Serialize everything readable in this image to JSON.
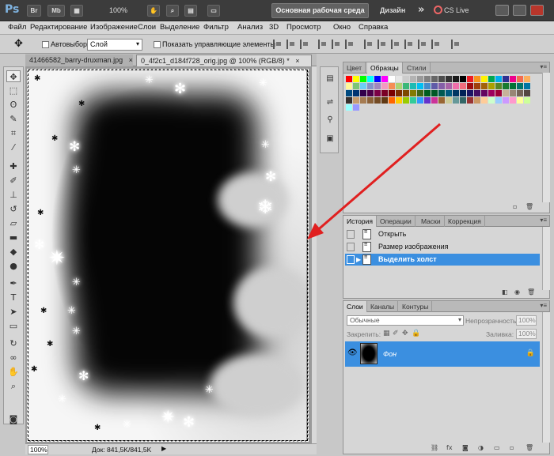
{
  "app": {
    "logo": "Ps",
    "btn_br": "Br",
    "btn_mb": "Mb",
    "zoom": "100%",
    "workspace_active": "Основная рабочая среда",
    "workspace_design": "Дизайн",
    "more": "»",
    "cs_live": "CS Live"
  },
  "menu": [
    "Файл",
    "Редактирование",
    "Изображение",
    "Слои",
    "Выделение",
    "Фильтр",
    "Анализ",
    "3D",
    "Просмотр",
    "Окно",
    "Справка"
  ],
  "options": {
    "autoselect_label": "Автовыбор:",
    "autoselect_value": "Слой",
    "show_controls_label": "Показать управляющие элементы"
  },
  "documents": {
    "tab1": "41466582_barry-druxman.jpg",
    "tab2": "0_4f2c1_d184f728_orig.jpg @ 100% (RGB/8) *",
    "close_glyph": "×"
  },
  "status": {
    "zoom": "100%",
    "doc_size": "Док: 841,5K/841,5K",
    "arrow": "▶"
  },
  "swatches_panel": {
    "tabs": [
      "Цвет",
      "Образцы",
      "Стили"
    ],
    "active_tab": 1,
    "colors": [
      "#ff0000",
      "#ffff00",
      "#00ff00",
      "#00ffff",
      "#0000ff",
      "#ff00ff",
      "#ffffff",
      "#e6e6e6",
      "#cccccc",
      "#b3b3b3",
      "#999999",
      "#808080",
      "#666666",
      "#4d4d4d",
      "#333333",
      "#1a1a1a",
      "#000000",
      "#ed1c24",
      "#f7941d",
      "#fff200",
      "#00a651",
      "#00aeef",
      "#2e3192",
      "#ec008c",
      "#f26c4f",
      "#fbaf5d",
      "#fff799",
      "#7cc576",
      "#6dcff6",
      "#8393ca",
      "#a186be",
      "#f49ac1",
      "#f68e56",
      "#acd373",
      "#3bb878",
      "#1cbbb4",
      "#00bff3",
      "#448ccb",
      "#605ca8",
      "#855fa8",
      "#a864a8",
      "#f06eaa",
      "#f26d7d",
      "#9e0b0f",
      "#a0410d",
      "#a3620a",
      "#aba000",
      "#598527",
      "#197b30",
      "#007236",
      "#00746b",
      "#0076a3",
      "#004a80",
      "#003471",
      "#32004b",
      "#4b0049",
      "#7b0046",
      "#7a0026",
      "#790000",
      "#7b2e00",
      "#7d4900",
      "#827b00",
      "#406618",
      "#005e20",
      "#005826",
      "#005952",
      "#005b7f",
      "#003663",
      "#002157",
      "#1b1464",
      "#440e62",
      "#630460",
      "#9e005d",
      "#9e0039",
      "#c7b299",
      "#998675",
      "#736357",
      "#534741",
      "#37302d",
      "#c69c6d",
      "#a67c52",
      "#8c6239",
      "#754c24",
      "#603913",
      "#ff6600",
      "#ffcc00",
      "#99cc00",
      "#33cc99",
      "#3399ff",
      "#6633cc",
      "#cc3399",
      "#996633",
      "#cccc99",
      "#669999",
      "#336666",
      "#993333",
      "#cc9966",
      "#ffcc99",
      "#ccffcc",
      "#99ccff",
      "#cc99ff",
      "#ff99cc",
      "#ffff99",
      "#ccff99",
      "#99ffff",
      "#9999ff"
    ]
  },
  "history_panel": {
    "tabs": [
      "История",
      "Операции",
      "Маски",
      "Коррекция"
    ],
    "active_tab": 0,
    "items": [
      {
        "label": "Открыть",
        "selected": false
      },
      {
        "label": "Размер изображения",
        "selected": false
      },
      {
        "label": "Выделить холст",
        "selected": true
      }
    ]
  },
  "layers_panel": {
    "tabs": [
      "Слои",
      "Каналы",
      "Контуры"
    ],
    "active_tab": 0,
    "blend_mode": "Обычные",
    "opacity_label": "Непрозрачность:",
    "opacity_value": "100%",
    "lock_label": "Закрепить:",
    "fill_label": "Заливка:",
    "fill_value": "100%",
    "layer_name": "Фон"
  },
  "icons": {
    "eye": "👁",
    "lock": "🔒"
  },
  "accent_color": "#3b8fe0",
  "annotation_arrow_color": "#e02020"
}
